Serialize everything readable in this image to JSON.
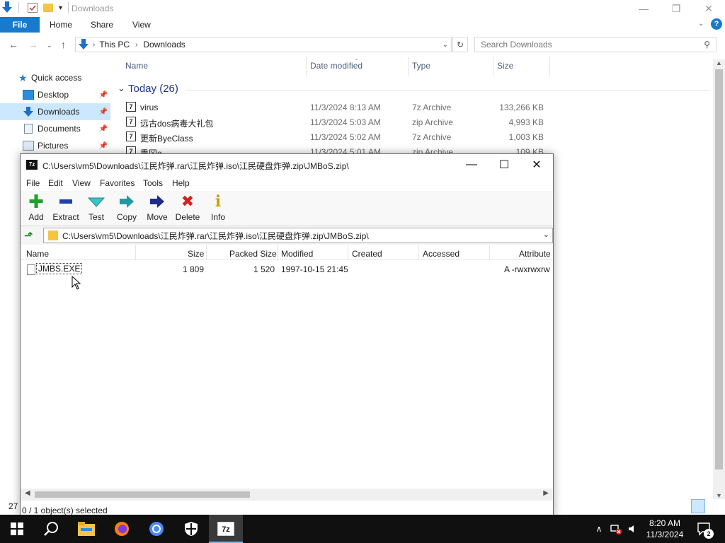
{
  "explorer": {
    "title": "Downloads",
    "ribbon_tabs": {
      "file": "File",
      "home": "Home",
      "share": "Share",
      "view": "View"
    },
    "breadcrumb": {
      "root": "This PC",
      "current": "Downloads"
    },
    "search_placeholder": "Search Downloads",
    "nav": {
      "quick_access": "Quick access",
      "desktop": "Desktop",
      "downloads": "Downloads",
      "documents": "Documents",
      "pictures": "Pictures"
    },
    "columns": {
      "name": "Name",
      "date": "Date modified",
      "type": "Type",
      "size": "Size"
    },
    "group": "Today (26)",
    "files": [
      {
        "name": "virus",
        "date": "11/3/2024 8:13 AM",
        "type": "7z Archive",
        "size": "133,266 KB"
      },
      {
        "name": "远古dos病毒大礼包",
        "date": "11/3/2024 5:03 AM",
        "type": "zip Archive",
        "size": "4,993 KB"
      },
      {
        "name": "更新ByeClass",
        "date": "11/3/2024 5:02 AM",
        "type": "7z Archive",
        "size": "1,003 KB"
      },
      {
        "name": "熏冈e",
        "date": "11/3/2024 5:01 AM",
        "type": "zip Archive",
        "size": "109 KB"
      }
    ],
    "status_count": "27"
  },
  "sevenzip": {
    "title": "C:\\Users\\vm5\\Downloads\\江民炸弹.rar\\江民炸弹.iso\\江民硬盘炸弹.zip\\JMBoS.zip\\",
    "logo_text": "7z",
    "menu": {
      "file": "File",
      "edit": "Edit",
      "view": "View",
      "favorites": "Favorites",
      "tools": "Tools",
      "help": "Help"
    },
    "toolbar": {
      "add": "Add",
      "extract": "Extract",
      "test": "Test",
      "copy": "Copy",
      "move": "Move",
      "delete": "Delete",
      "info": "Info"
    },
    "path": "C:\\Users\\vm5\\Downloads\\江民炸弹.rar\\江民炸弹.iso\\江民硬盘炸弹.zip\\JMBoS.zip\\",
    "columns": {
      "name": "Name",
      "size": "Size",
      "packed": "Packed Size",
      "modified": "Modified",
      "created": "Created",
      "accessed": "Accessed",
      "attributes": "Attribute"
    },
    "rows": [
      {
        "name": "JMBS.EXE",
        "size": "1 809",
        "packed": "1 520",
        "modified": "1997-10-15 21:45",
        "attributes": "A -rwxrwxrw"
      }
    ],
    "status": "0 / 1 object(s) selected"
  },
  "taskbar": {
    "time": "8:20 AM",
    "date": "11/3/2024",
    "notification_count": "2",
    "active_app_label": "7z"
  }
}
